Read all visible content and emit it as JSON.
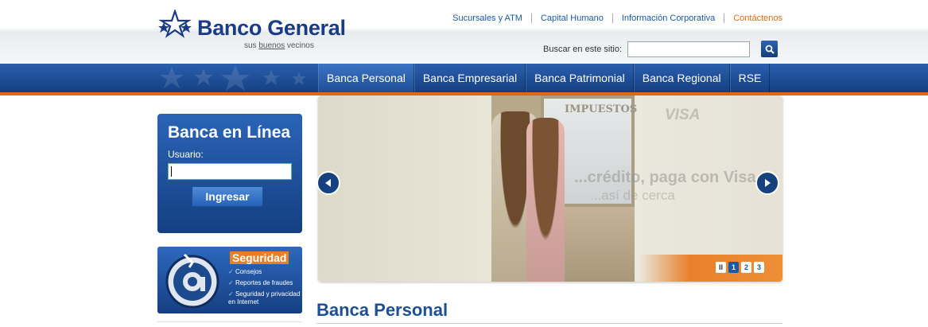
{
  "brand": {
    "name": "Banco General",
    "tagline_prefix": "sus ",
    "tagline_underlined": "buenos",
    "tagline_suffix": " vecinos"
  },
  "toplinks": [
    {
      "label": "Sucursales y ATM"
    },
    {
      "label": "Capital Humano"
    },
    {
      "label": "Información Corporativa"
    },
    {
      "label": "Contáctenos"
    }
  ],
  "search": {
    "label": "Buscar en este sitio:",
    "value": ""
  },
  "nav": [
    {
      "label": "Banca Personal",
      "active": true
    },
    {
      "label": "Banca Empresarial"
    },
    {
      "label": "Banca Patrimonial"
    },
    {
      "label": "Banca Regional"
    },
    {
      "label": "RSE"
    }
  ],
  "login": {
    "title": "Banca en Línea",
    "user_label": "Usuario:",
    "button": "Ingresar"
  },
  "security": {
    "title": "Seguridad",
    "items": [
      "Consejos",
      "Reportes de fraudes",
      "Seguridad y privacidad en Internet"
    ]
  },
  "carousel": {
    "sign_text": "IMPUESTOS",
    "ghost_logo": "VISA",
    "promo_line1": "...crédito, paga con Visa",
    "promo_line2": "...así de cerca",
    "pager": {
      "pause": "II",
      "pages": [
        "1",
        "2",
        "3"
      ],
      "current": 1
    }
  },
  "section": {
    "title": "Banca Personal"
  },
  "colors": {
    "brand_blue": "#1a3c86",
    "accent_orange": "#e06a1a",
    "nav_blue": "#1f4f97"
  }
}
